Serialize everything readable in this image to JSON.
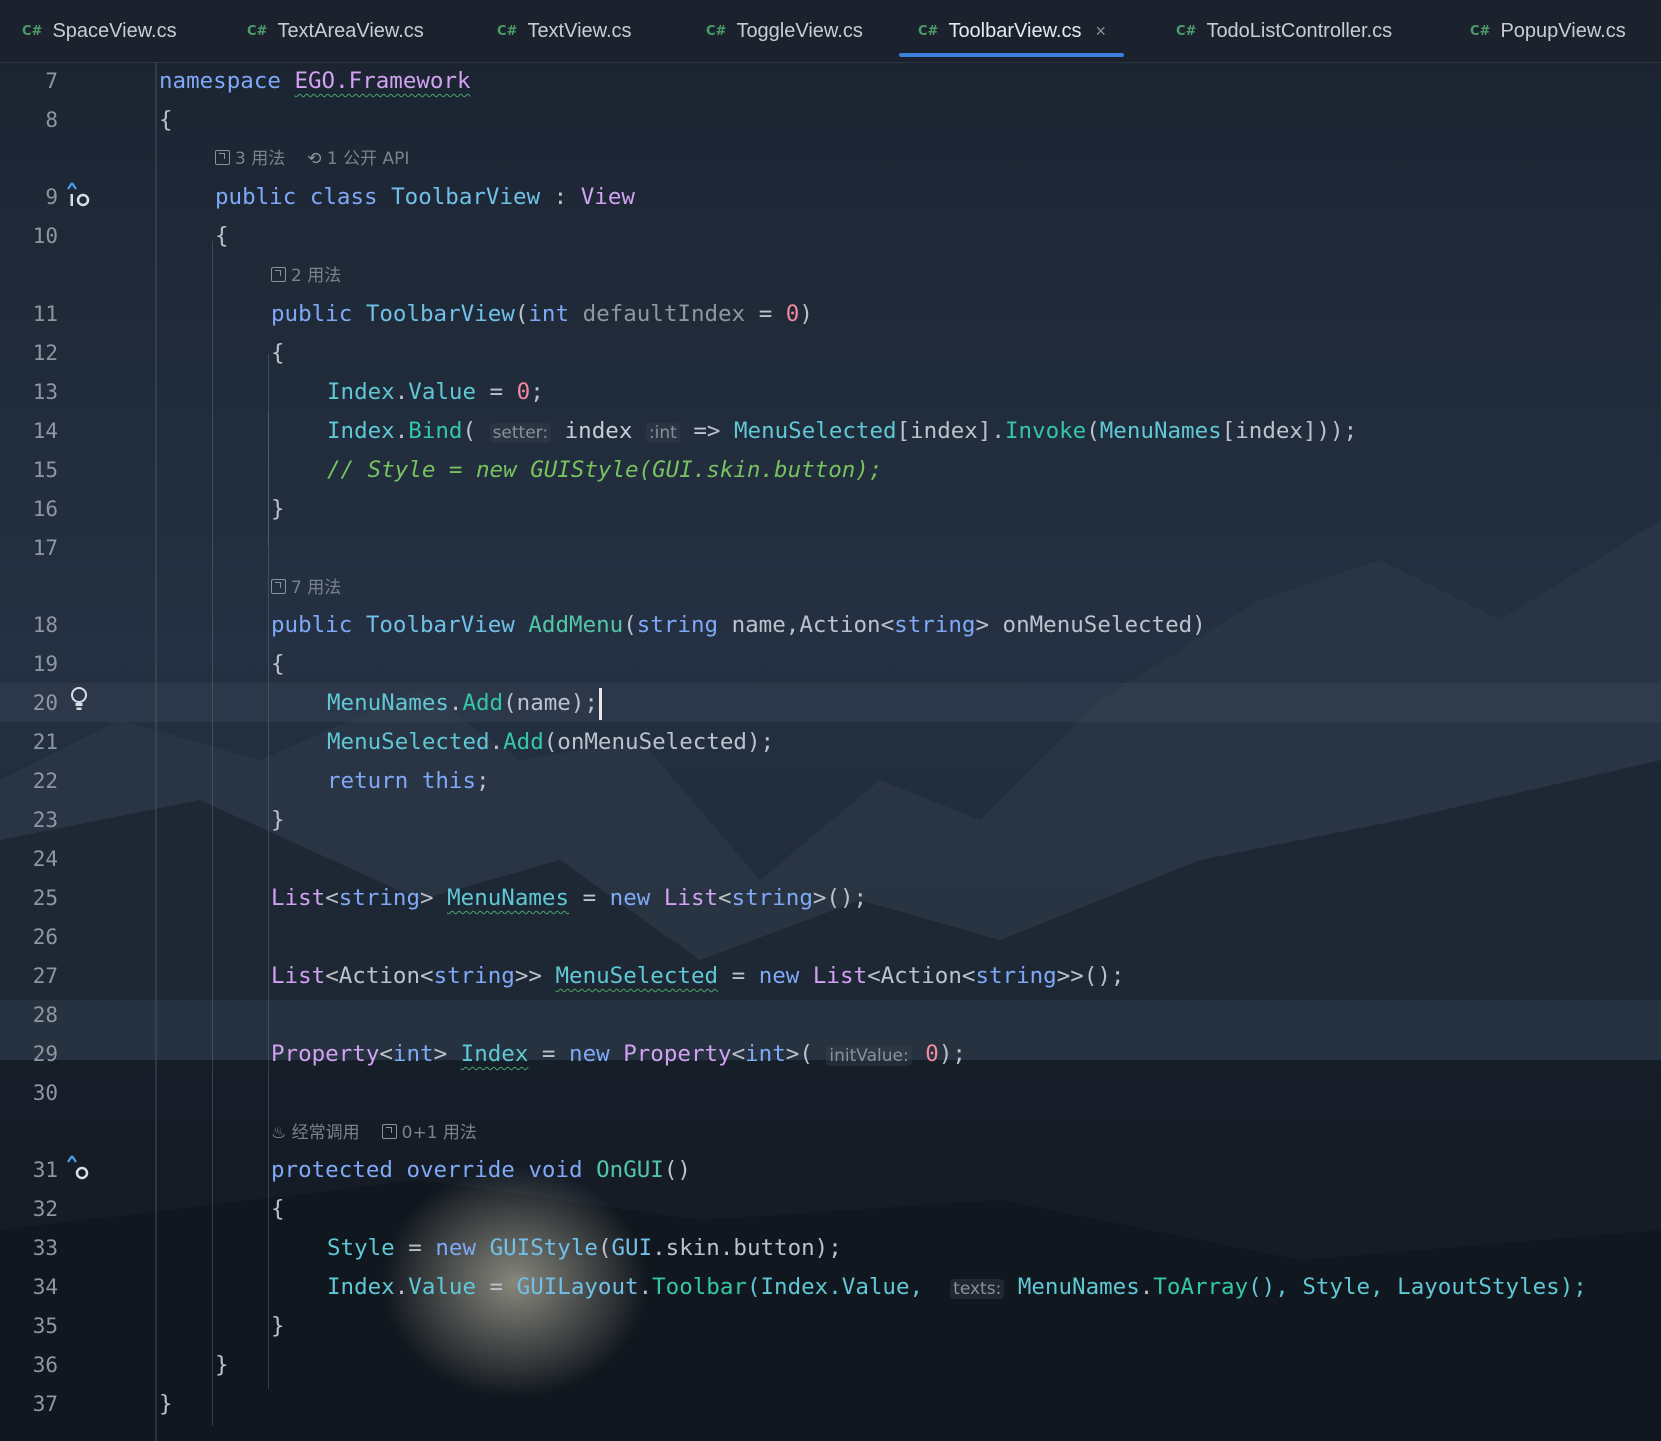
{
  "tabs": [
    {
      "lang": "C#",
      "name": "SpaceView.cs"
    },
    {
      "lang": "C#",
      "name": "TextAreaView.cs"
    },
    {
      "lang": "C#",
      "name": "TextView.cs"
    },
    {
      "lang": "C#",
      "name": "ToggleView.cs"
    },
    {
      "lang": "C#",
      "name": "ToolbarView.cs",
      "active": true,
      "close": "×"
    },
    {
      "lang": "C#",
      "name": "TodoListController.cs"
    },
    {
      "lang": "C#",
      "name": "PopupView.cs"
    }
  ],
  "line_numbers": [
    "7",
    "8",
    "9",
    "10",
    "11",
    "12",
    "13",
    "14",
    "15",
    "16",
    "17",
    "18",
    "19",
    "20",
    "21",
    "22",
    "23",
    "24",
    "25",
    "26",
    "27",
    "28",
    "29",
    "30",
    "31",
    "32",
    "33",
    "34",
    "35",
    "36",
    "37"
  ],
  "hints": {
    "class_usages": "3 用法",
    "class_api": "1 公开 API",
    "ctor_usages": "2 用法",
    "addmenu_usages": "7 用法",
    "ongui_frequent": "经常调用",
    "ongui_usages": "0+1 用法"
  },
  "code": {
    "l7_kw": "namespace",
    "l7_ns": "EGO.Framework",
    "brace_open": "{",
    "brace_close": "}",
    "l9_public": "public",
    "l9_class": "class",
    "l9_name": "ToolbarView",
    "l9_colon": ":",
    "l9_base": "View",
    "l11_public": "public",
    "l11_name": "ToolbarView",
    "l11_open": "(",
    "l11_int": "int",
    "l11_param": "defaultIndex",
    "l11_eq": "=",
    "l11_zero": "0",
    "l11_close": ")",
    "l13_index": "Index",
    "l13_dot": ".",
    "l13_value": "Value",
    "l13_eq": " = ",
    "l13_zero": "0",
    "l13_semi": ";",
    "l14_index": "Index",
    "l14_bind": "Bind",
    "l14_setter_hint": "setter:",
    "l14_param": "index",
    "l14_type_hint": ":int",
    "l14_arrow": " => ",
    "l14_ms": "MenuSelected",
    "l14_idx": "[index].",
    "l14_invoke": "Invoke",
    "l14_open": "(",
    "l14_mn": "MenuNames",
    "l14_tail": "[index]));",
    "l15_comment": "// Style = new GUIStyle(GUI.skin.button);",
    "l18_public": "public",
    "l18_type": "ToolbarView",
    "l18_fn": "AddMenu",
    "l18_open": "(",
    "l18_string": "string",
    "l18_name": " name,",
    "l18_action": "Action",
    "l18_lt": "<",
    "l18_string2": "string",
    "l18_gt": ">",
    "l18_param2": " onMenuSelected)",
    "l20_mn": "MenuNames",
    "l20_dot": ".",
    "l20_add": "Add",
    "l20_rest": "(name);",
    "l21_ms": "MenuSelected",
    "l21_dot": ".",
    "l21_add": "Add",
    "l21_rest": "(onMenuSelected);",
    "l22_return": "return",
    "l22_this": "this",
    "l22_semi": ";",
    "l25_list": "List",
    "l25_lt": "<",
    "l25_string": "string",
    "l25_gt": "> ",
    "l25_field": "MenuNames",
    "l25_eq": " = ",
    "l25_new": "new",
    "l25_list2": "List",
    "l25_string2": "string",
    "l25_tail": ">();",
    "l27_list": "List",
    "l27_action": "Action",
    "l27_string": "string",
    "l27_field": "MenuSelected",
    "l27_new": "new",
    "l27_tail": ">>();",
    "l29_prop": "Property",
    "l29_int": "int",
    "l29_field": "Index",
    "l29_new": "new",
    "l29_prop2": "Property",
    "l29_int2": "int",
    "l29_hint": "initValue:",
    "l29_zero": "0",
    "l29_tail": ");",
    "l31_protected": "protected",
    "l31_override": "override",
    "l31_void": "void",
    "l31_fn": "OnGUI",
    "l31_parens": "()",
    "l33_style": "Style",
    "l33_eq": " = ",
    "l33_new": "new",
    "l33_gs": "GUIStyle",
    "l33_open": "(",
    "l33_gui": "GUI",
    "l33_skin": ".skin.button);",
    "l34_index": "Index",
    "l34_value": "Value",
    "l34_eq": " = ",
    "l34_gl": "GUILayout",
    "l34_tb": "Toolbar",
    "l34_args": "(Index.Value, ",
    "l34_hint": "texts:",
    "l34_mn": "MenuNames",
    "l34_toarray": "ToArray",
    "l34_tail": "(), Style, LayoutStyles);"
  }
}
